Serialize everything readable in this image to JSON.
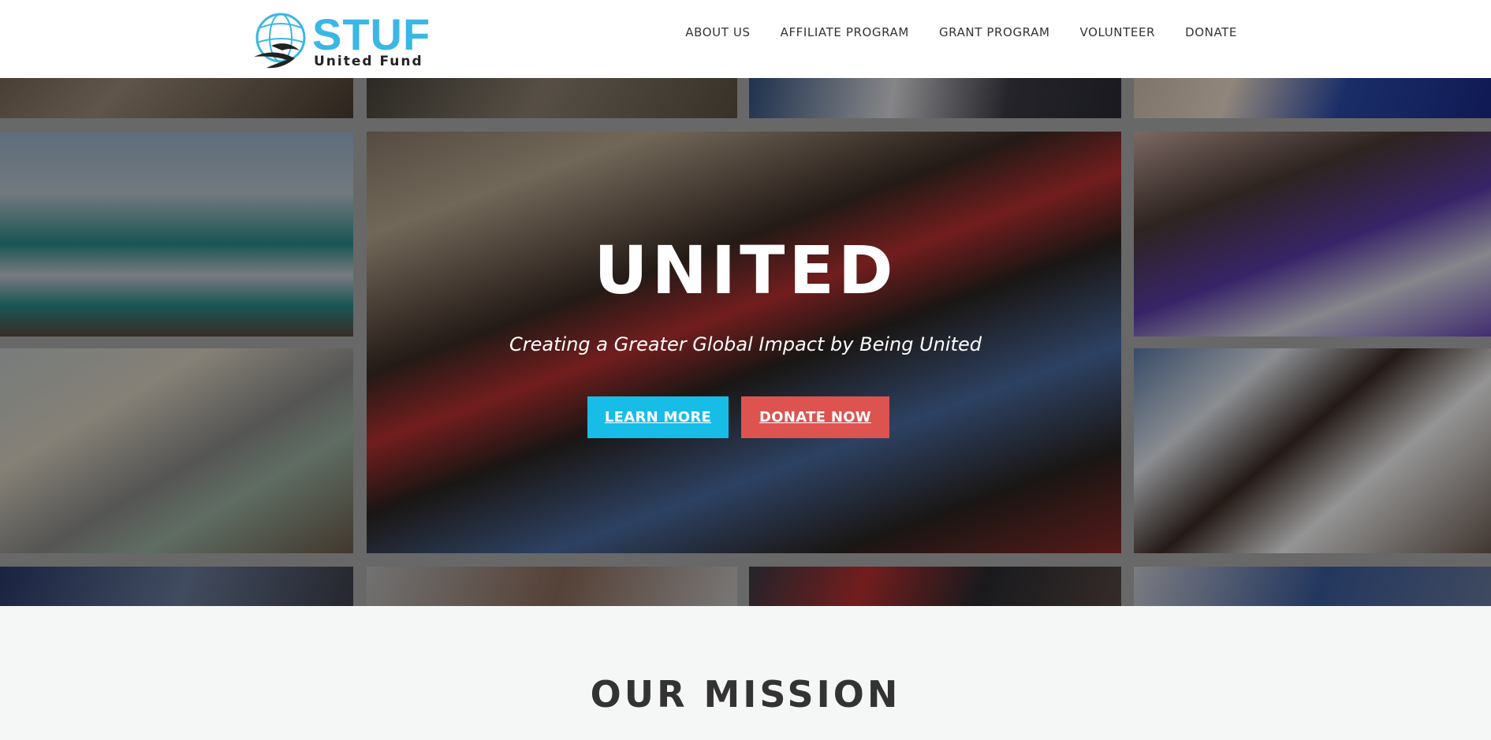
{
  "logo": {
    "name": "STUF",
    "subtitle": "United Fund",
    "icon": "globe-icon",
    "color": "#3ab7e5"
  },
  "nav": {
    "items": [
      {
        "label": "ABOUT US"
      },
      {
        "label": "AFFILIATE PROGRAM"
      },
      {
        "label": "GRANT PROGRAM"
      },
      {
        "label": "VOLUNTEER"
      },
      {
        "label": "DONATE"
      }
    ]
  },
  "hero": {
    "title": "UNITED",
    "subtitle": "Creating a Greater Global Impact by Being United",
    "learn_more_label": "LEARN MORE",
    "donate_label": "DONATE NOW",
    "learn_more_color": "#18bde7",
    "donate_color": "#dc5350"
  },
  "mission": {
    "title": "OUR MISSION"
  }
}
